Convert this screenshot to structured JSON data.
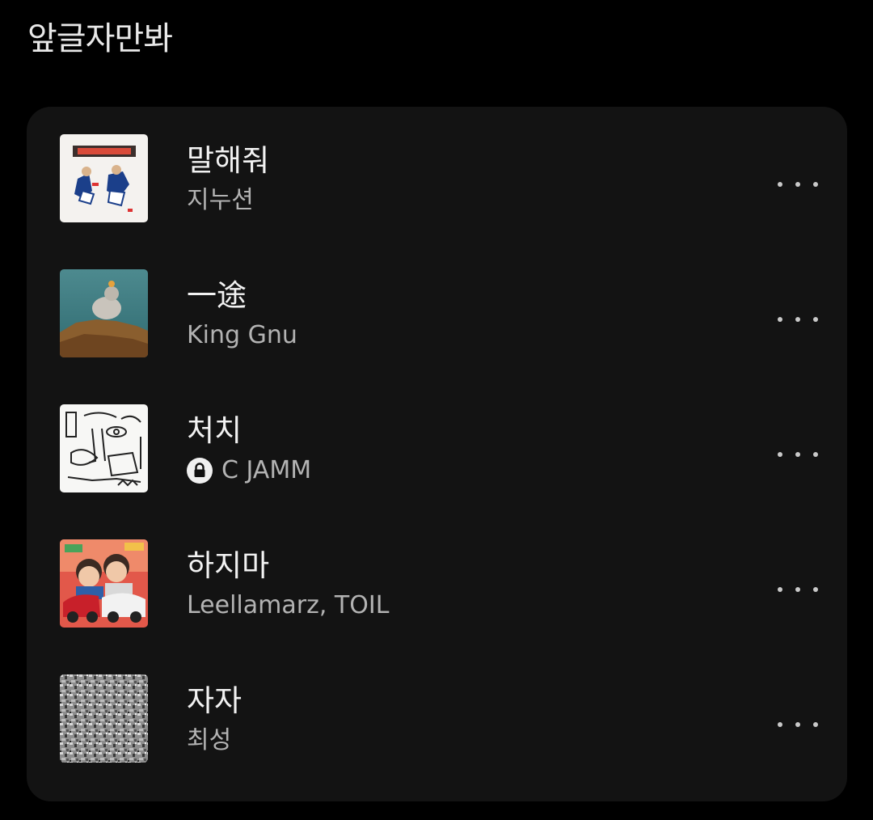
{
  "header": {
    "title": "앞글자만봐"
  },
  "colors": {
    "background": "#000000",
    "card": "#131313",
    "title_text": "#f2f2f2",
    "artist_text": "#b3b3b3"
  },
  "tracks": [
    {
      "title": "말해줘",
      "artist": "지누션",
      "cover_icon": "album-cover",
      "more_icon": "more-options-icon"
    },
    {
      "title": "一途",
      "artist": "King Gnu",
      "cover_icon": "album-cover",
      "more_icon": "more-options-icon"
    },
    {
      "title": "처치",
      "artist": "C JAMM",
      "locked": true,
      "lock_icon": "lock-icon",
      "cover_icon": "album-cover",
      "more_icon": "more-options-icon"
    },
    {
      "title": "하지마",
      "artist": "Leellamarz, TOIL",
      "cover_icon": "album-cover",
      "more_icon": "more-options-icon"
    },
    {
      "title": "자자",
      "artist": "최성",
      "cover_icon": "album-cover",
      "more_icon": "more-options-icon"
    }
  ]
}
